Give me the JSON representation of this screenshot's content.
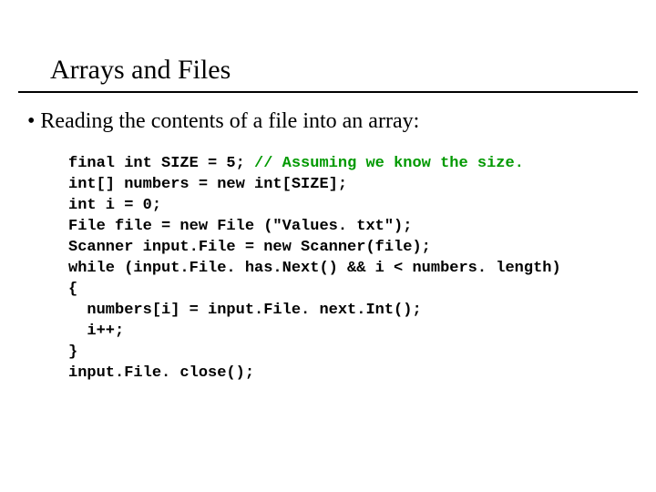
{
  "title": "Arrays and Files",
  "bullet": "Reading the contents of a file into an array:",
  "code": {
    "l1a": "final int SIZE = 5; ",
    "l1b": "// Assuming we know the size.",
    "l2": "int[] numbers = new int[SIZE];",
    "l3": "int i = 0;",
    "l4": "File file = new File (\"Values. txt\");",
    "l5": "Scanner input.File = new Scanner(file);",
    "l6": "while (input.File. has.Next() && i < numbers. length)",
    "l7": "{",
    "l8": "  numbers[i] = input.File. next.Int();",
    "l9": "  i++;",
    "l10": "}",
    "l11": "input.File. close();"
  }
}
